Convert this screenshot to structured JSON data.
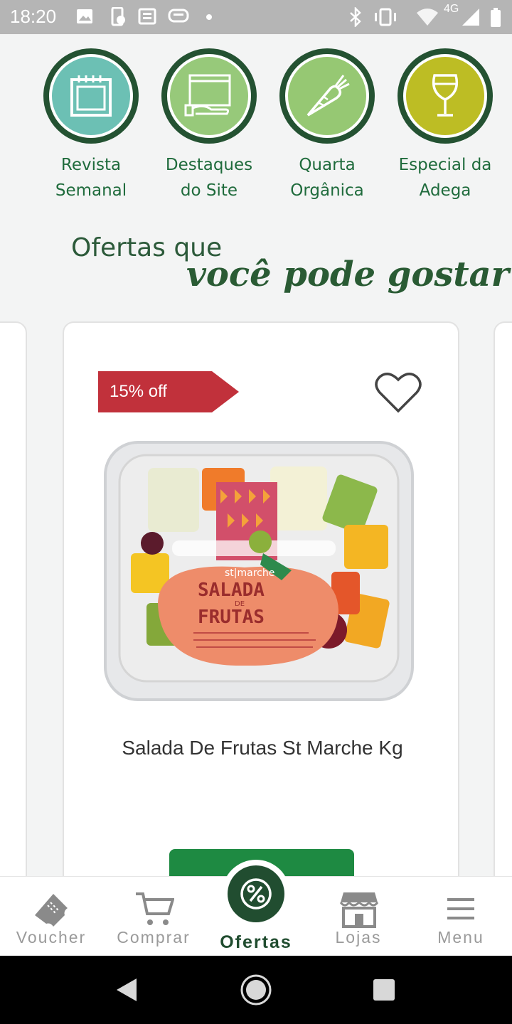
{
  "status_bar": {
    "time": "18:20",
    "network": "4G"
  },
  "categories": [
    {
      "line1": "Revista",
      "line2": "Semanal",
      "icon": "calendar-icon",
      "color": "#6cc0b4"
    },
    {
      "line1": "Destaques",
      "line2": "do Site",
      "icon": "browser-hand-icon",
      "color": "#97c97a"
    },
    {
      "line1": "Quarta",
      "line2": "Orgânica",
      "icon": "carrot-icon",
      "color": "#96c873"
    },
    {
      "line1": "Especial da",
      "line2": "Adega",
      "icon": "wine-glass-icon",
      "color": "#bdbd24"
    }
  ],
  "offers": {
    "title": "Ofertas que",
    "script": "você pode gostar"
  },
  "product": {
    "discount": "15% off",
    "name": "Salada De Frutas St Marche Kg",
    "package_brand": "st|marche",
    "package_title1": "SALADA",
    "package_title2": "DE",
    "package_title3": "FRUTAS",
    "favorite_icon": "heart-outline-icon"
  },
  "bottom_nav": [
    {
      "label": "Voucher",
      "icon": "ticket-icon"
    },
    {
      "label": "Comprar",
      "icon": "cart-icon"
    },
    {
      "label": "Ofertas",
      "icon": "percent-icon",
      "active": true
    },
    {
      "label": "Lojas",
      "icon": "store-icon"
    },
    {
      "label": "Menu",
      "icon": "hamburger-icon"
    }
  ],
  "colors": {
    "brand_green": "#214d30",
    "label_green": "#1f6b3c",
    "discount_red": "#c1313b",
    "button_green": "#1e8a42"
  }
}
